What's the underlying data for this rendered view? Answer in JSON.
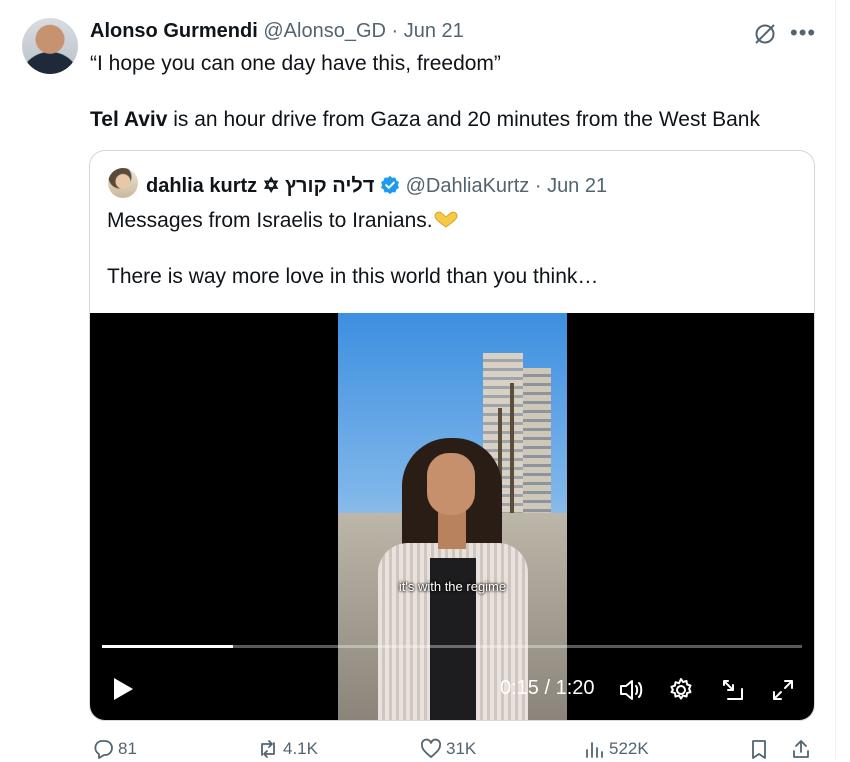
{
  "tweet": {
    "author_name": "Alonso Gurmendi",
    "handle": "@Alonso_GD",
    "date": "Jun 21",
    "separator": "·",
    "line1": "“I hope you can one day have this, freedom”",
    "line2_bold": "Tel Aviv",
    "line2_rest": " is an hour drive from Gaza and 20 minutes from the West Bank",
    "more_label": "•••"
  },
  "quote": {
    "author_name": "dahlia kurtz ✡ דליה קורץ",
    "handle": "@DahliaKurtz",
    "date": "Jun 21",
    "separator": "·",
    "text1": "Messages from Israelis to Iranians.",
    "text2": "There is way more love in this world than you think…",
    "video": {
      "caption": "it's with the regime",
      "time": "0:15 / 1:20",
      "progress": 0.1875
    }
  },
  "actions": {
    "replies": "81",
    "reposts": "4.1K",
    "likes": "31K",
    "views": "522K"
  },
  "colors": {
    "verified": "#1d9bf0",
    "muted": "#536471",
    "heart_emoji": "#f7c948"
  },
  "icons": [
    "grok-icon",
    "more-icon",
    "verified-badge-icon",
    "heart-hands-icon",
    "play-icon",
    "volume-icon",
    "settings-icon",
    "picture-in-picture-icon",
    "fullscreen-icon",
    "reply-icon",
    "repost-icon",
    "like-icon",
    "views-icon",
    "bookmark-icon",
    "share-icon"
  ]
}
